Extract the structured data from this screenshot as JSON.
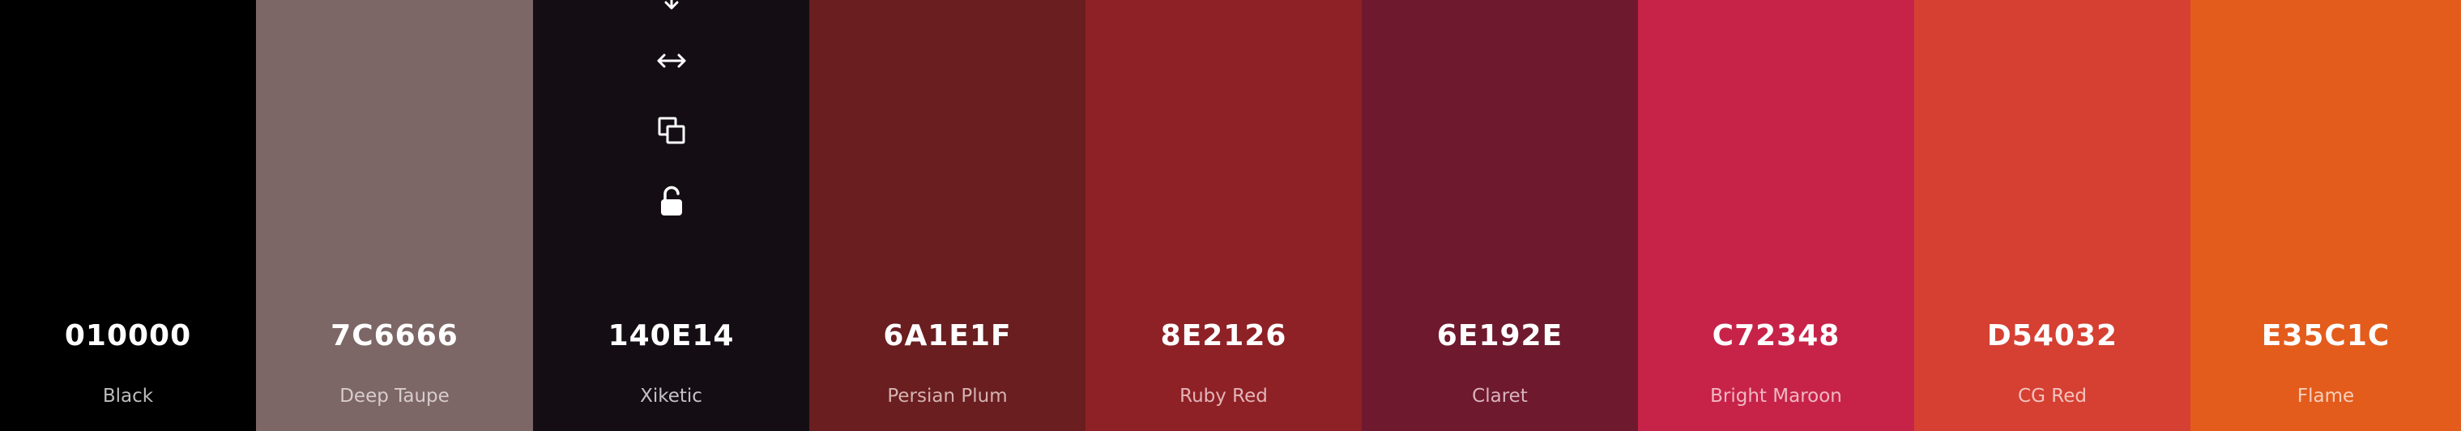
{
  "colors": [
    {
      "hex": "010000",
      "name": "Black",
      "bg": "#010000",
      "hex_color": "#ffffff",
      "name_color": "#bdbdbd"
    },
    {
      "hex": "7C6666",
      "name": "Deep Taupe",
      "bg": "#7C6666",
      "hex_color": "#ffffff",
      "name_color": "#d8cccc"
    },
    {
      "hex": "140E14",
      "name": "Xiketic",
      "bg": "#140E14",
      "hex_color": "#ffffff",
      "name_color": "#c6c1c6"
    },
    {
      "hex": "6A1E1F",
      "name": "Persian Plum",
      "bg": "#6A1E1F",
      "hex_color": "#ffffff",
      "name_color": "#d6b2b2"
    },
    {
      "hex": "8E2126",
      "name": "Ruby Red",
      "bg": "#8E2126",
      "hex_color": "#ffffff",
      "name_color": "#e2b5b7"
    },
    {
      "hex": "6E192E",
      "name": "Claret",
      "bg": "#6E192E",
      "hex_color": "#ffffff",
      "name_color": "#d9b3bd"
    },
    {
      "hex": "C72348",
      "name": "Bright Maroon",
      "bg": "#C72348",
      "hex_color": "#ffffff",
      "name_color": "#f0b8c4"
    },
    {
      "hex": "D54032",
      "name": "CG Red",
      "bg": "#D54032",
      "hex_color": "#ffffff",
      "name_color": "#f4c3be"
    },
    {
      "hex": "E35C1C",
      "name": "Flame",
      "bg": "#E35C1C",
      "hex_color": "#ffffff",
      "name_color": "#f8d0bd"
    }
  ],
  "toolbar_icons": [
    "drag-vertical-icon",
    "swap-horizontal-icon",
    "copy-icon",
    "unlock-icon"
  ]
}
